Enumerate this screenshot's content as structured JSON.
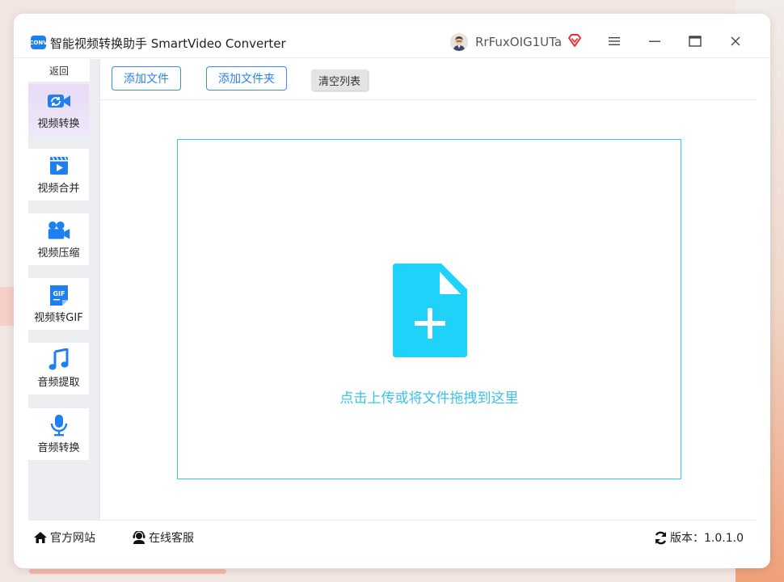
{
  "titlebar": {
    "logo_text": "CONV",
    "title": "智能视频转换助手 SmartVideo Converter",
    "username": "RrFuxOIG1UTa",
    "icons": [
      "avatar-icon",
      "vip-icon",
      "menu-icon",
      "minimize-icon",
      "maximize-icon",
      "close-icon"
    ]
  },
  "sidebar": {
    "back_label": "返回",
    "items": [
      {
        "label": "视频转换",
        "icon": "video-convert-icon",
        "active": true
      },
      {
        "label": "视频合并",
        "icon": "video-merge-icon",
        "active": false
      },
      {
        "label": "视频压缩",
        "icon": "video-compress-icon",
        "active": false
      },
      {
        "label": "视频转GIF",
        "icon": "gif-icon",
        "active": false
      },
      {
        "label": "音频提取",
        "icon": "music-note-icon",
        "active": false
      },
      {
        "label": "音频转换",
        "icon": "microphone-icon",
        "active": false
      }
    ]
  },
  "toolbar": {
    "add_file": "添加文件",
    "add_folder": "添加文件夹",
    "clear_list": "清空列表"
  },
  "dropzone": {
    "text": "点击上传或将文件拖拽到这里",
    "icon": "file-add-icon"
  },
  "footer": {
    "website": "官方网站",
    "support": "在线客服",
    "version": "版本：1.0.1.0",
    "icons": [
      "home-icon",
      "support-agent-icon",
      "refresh-icon"
    ]
  },
  "colors": {
    "accent": "#2a82e4",
    "dropzone_border": "#3cc4ea",
    "upload_icon": "#1ed2fa",
    "active_nav": "#e7dbf6"
  }
}
